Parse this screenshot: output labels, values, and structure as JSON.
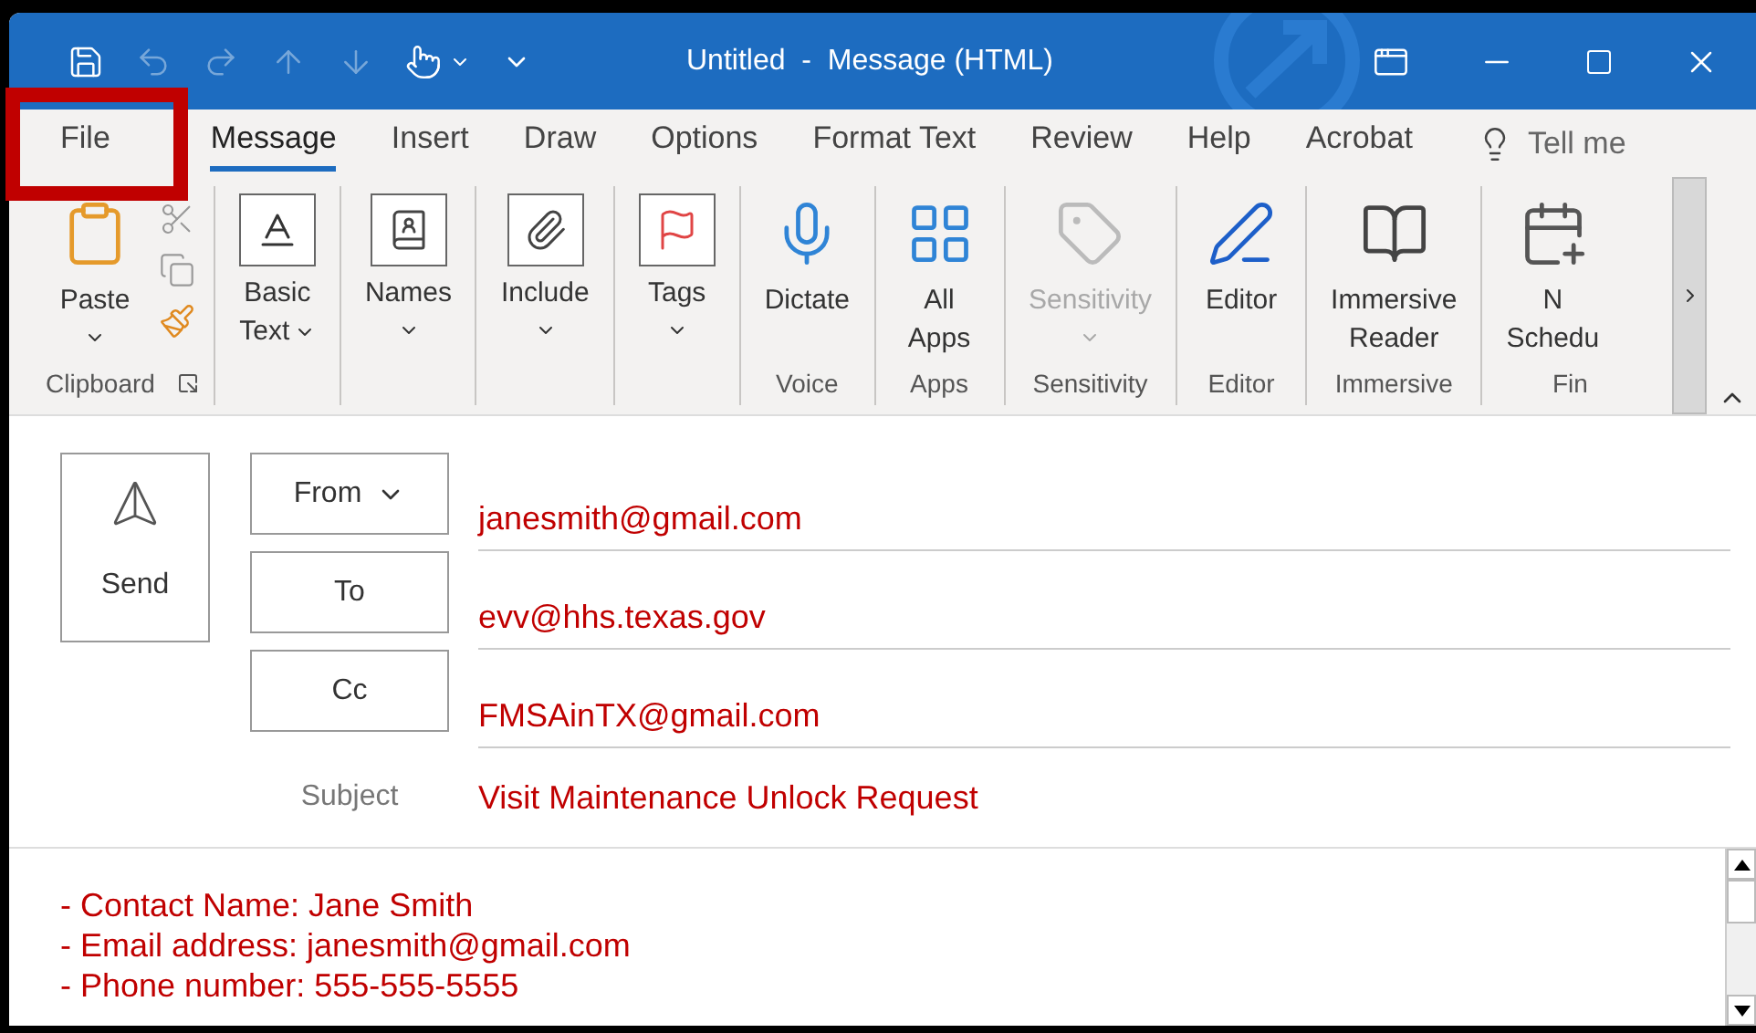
{
  "window": {
    "title": "Untitled  -  Message (HTML)"
  },
  "tabs": [
    {
      "label": "File",
      "selected": false
    },
    {
      "label": "Message",
      "selected": true
    },
    {
      "label": "Insert",
      "selected": false
    },
    {
      "label": "Draw",
      "selected": false
    },
    {
      "label": "Options",
      "selected": false
    },
    {
      "label": "Format Text",
      "selected": false
    },
    {
      "label": "Review",
      "selected": false
    },
    {
      "label": "Help",
      "selected": false
    },
    {
      "label": "Acrobat",
      "selected": false
    }
  ],
  "tell_me": {
    "placeholder": "Tell me"
  },
  "ribbon": {
    "groups": [
      {
        "label": "Clipboard",
        "buttons": [
          {
            "lines": [
              "Paste"
            ],
            "dropdown": true,
            "disabled": false
          }
        ]
      },
      {
        "buttons": [
          {
            "lines": [
              "Basic",
              "Text"
            ],
            "dropdown": true,
            "disabled": false
          }
        ]
      },
      {
        "buttons": [
          {
            "lines": [
              "Names"
            ],
            "dropdown": true,
            "disabled": false
          }
        ]
      },
      {
        "buttons": [
          {
            "lines": [
              "Include"
            ],
            "dropdown": true,
            "disabled": false
          }
        ]
      },
      {
        "buttons": [
          {
            "lines": [
              "Tags"
            ],
            "dropdown": true,
            "disabled": false
          }
        ]
      },
      {
        "label": "Voice",
        "buttons": [
          {
            "lines": [
              "Dictate"
            ],
            "dropdown": false,
            "disabled": false
          }
        ]
      },
      {
        "label": "Apps",
        "buttons": [
          {
            "lines": [
              "All",
              "Apps"
            ],
            "dropdown": false,
            "disabled": false
          }
        ]
      },
      {
        "label": "Sensitivity",
        "buttons": [
          {
            "lines": [
              "Sensitivity"
            ],
            "dropdown": true,
            "disabled": true
          }
        ]
      },
      {
        "label": "Editor",
        "buttons": [
          {
            "lines": [
              "Editor"
            ],
            "dropdown": false,
            "disabled": false
          }
        ]
      },
      {
        "label": "Immersive",
        "buttons": [
          {
            "lines": [
              "Immersive",
              "Reader"
            ],
            "dropdown": false,
            "disabled": false
          }
        ]
      },
      {
        "label": "Fin",
        "buttons": [
          {
            "lines": [
              "N",
              "Schedu"
            ],
            "dropdown": false,
            "disabled": false
          }
        ]
      }
    ]
  },
  "compose": {
    "send": "Send",
    "fields": [
      {
        "button": "From",
        "dropdown": true,
        "value": "janesmith@gmail.com"
      },
      {
        "button": "To",
        "dropdown": false,
        "value": "evv@hhs.texas.gov"
      },
      {
        "button": "Cc",
        "dropdown": false,
        "value": "FMSAinTX@gmail.com"
      }
    ],
    "subject": {
      "label": "Subject",
      "value": "Visit Maintenance Unlock Request"
    }
  },
  "body": {
    "lines": [
      "- Contact Name: Jane Smith",
      "- Email address: janesmith@gmail.com",
      "- Phone number: 555-555-5555"
    ]
  }
}
